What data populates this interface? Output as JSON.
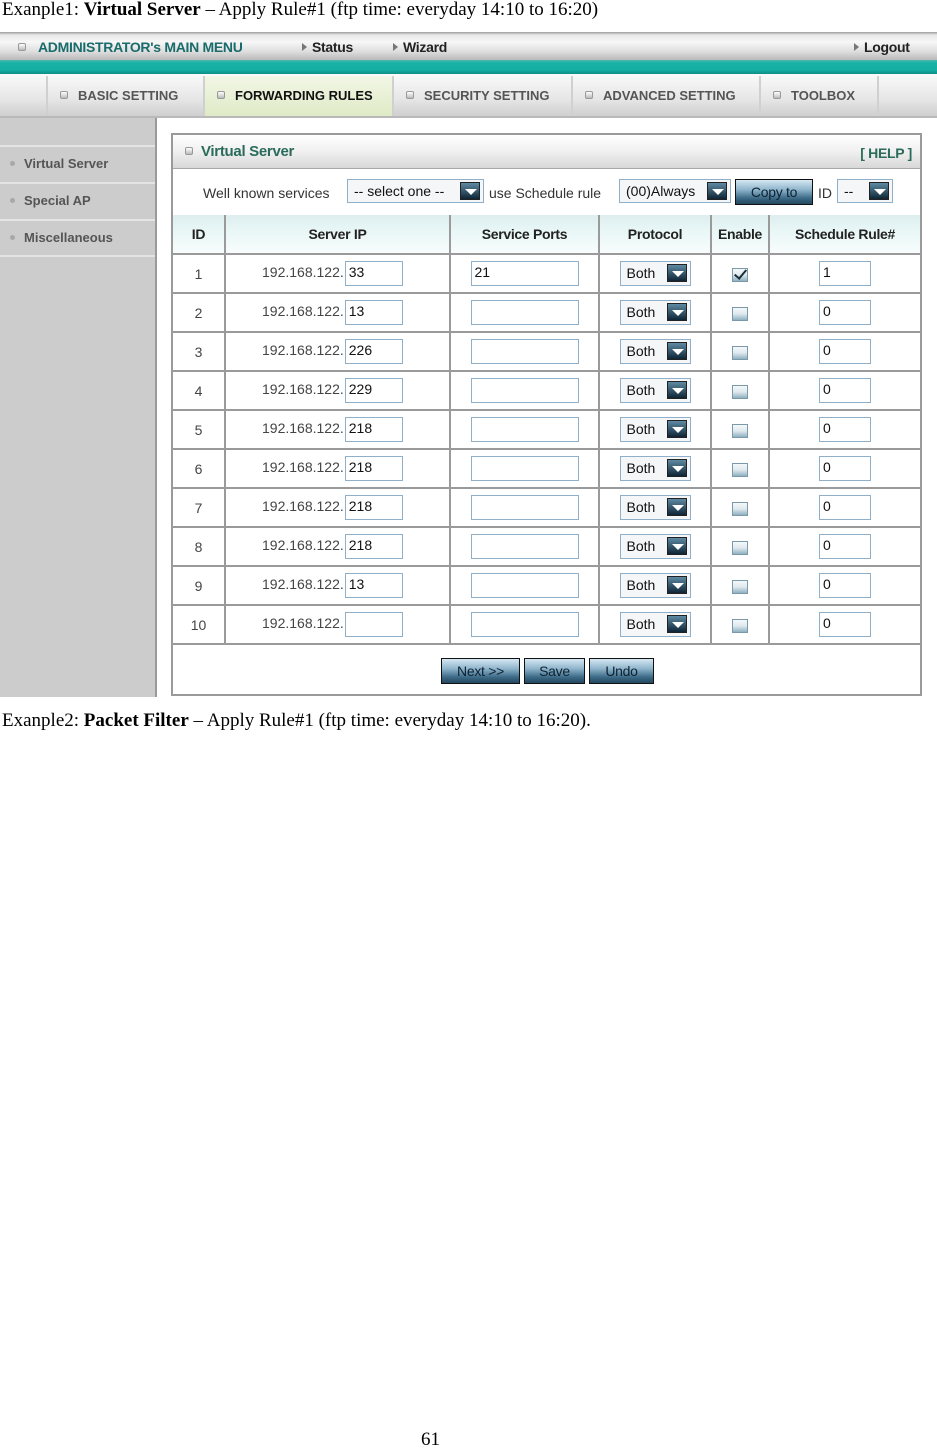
{
  "document": {
    "caption1": {
      "prefix": "Exanple1: ",
      "bold": "Virtual Server",
      "suffix": " – Apply Rule#1 (ftp time: everyday 14:10 to 16:20)"
    },
    "caption2": {
      "prefix": "Exanple2: ",
      "bold": "Packet Filter",
      "suffix": " – Apply Rule#1 (ftp time: everyday 14:10 to 16:20)."
    },
    "page_number": "61"
  },
  "topbar": {
    "admin_menu": "ADMINISTRATOR's MAIN MENU",
    "status": "Status",
    "wizard": "Wizard",
    "logout": "Logout"
  },
  "tabs": [
    {
      "label": "BASIC SETTING",
      "active": false
    },
    {
      "label": "FORWARDING RULES",
      "active": true
    },
    {
      "label": "SECURITY SETTING",
      "active": false
    },
    {
      "label": "ADVANCED SETTING",
      "active": false
    },
    {
      "label": "TOOLBOX",
      "active": false
    }
  ],
  "sidebar": {
    "items": [
      {
        "label": "Virtual Server"
      },
      {
        "label": "Special AP"
      },
      {
        "label": "Miscellaneous"
      }
    ]
  },
  "panel": {
    "title": "Virtual Server",
    "help": "[ HELP ]",
    "well_known_label": "Well known services",
    "well_known_value": "-- select one --",
    "schedule_label": "use Schedule rule",
    "schedule_value": "(00)Always",
    "copy_button": "Copy to",
    "id_label": "ID",
    "id_value": "--"
  },
  "table": {
    "headers": [
      "ID",
      "Server IP",
      "Service Ports",
      "Protocol",
      "Enable",
      "Schedule Rule#"
    ],
    "ip_prefix": "192.168.122.",
    "rows": [
      {
        "id": "1",
        "ip": "33",
        "ports": "21",
        "protocol": "Both",
        "enabled": true,
        "schedule": "1"
      },
      {
        "id": "2",
        "ip": "13",
        "ports": "",
        "protocol": "Both",
        "enabled": false,
        "schedule": "0"
      },
      {
        "id": "3",
        "ip": "226",
        "ports": "",
        "protocol": "Both",
        "enabled": false,
        "schedule": "0"
      },
      {
        "id": "4",
        "ip": "229",
        "ports": "",
        "protocol": "Both",
        "enabled": false,
        "schedule": "0"
      },
      {
        "id": "5",
        "ip": "218",
        "ports": "",
        "protocol": "Both",
        "enabled": false,
        "schedule": "0"
      },
      {
        "id": "6",
        "ip": "218",
        "ports": "",
        "protocol": "Both",
        "enabled": false,
        "schedule": "0"
      },
      {
        "id": "7",
        "ip": "218",
        "ports": "",
        "protocol": "Both",
        "enabled": false,
        "schedule": "0"
      },
      {
        "id": "8",
        "ip": "218",
        "ports": "",
        "protocol": "Both",
        "enabled": false,
        "schedule": "0"
      },
      {
        "id": "9",
        "ip": "13",
        "ports": "",
        "protocol": "Both",
        "enabled": false,
        "schedule": "0"
      },
      {
        "id": "10",
        "ip": "",
        "ports": "",
        "protocol": "Both",
        "enabled": false,
        "schedule": "0"
      }
    ]
  },
  "actions": {
    "next": "Next >>",
    "save": "Save",
    "undo": "Undo"
  },
  "colors": {
    "accent_teal": "#14aea2",
    "title_green": "#2a6b5a",
    "active_tab": "#dfeac6"
  }
}
